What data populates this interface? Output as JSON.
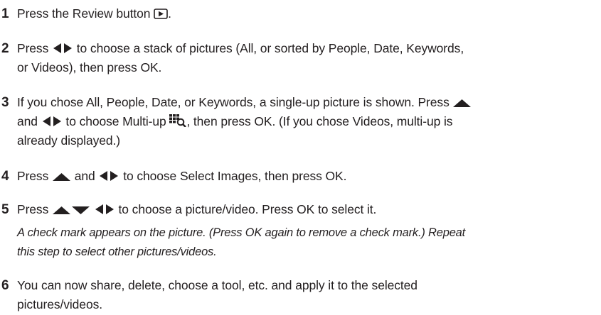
{
  "steps": [
    {
      "num": "1",
      "parts": [
        "Press the Review button ",
        "."
      ]
    },
    {
      "num": "2",
      "parts": [
        "Press ",
        " to choose a stack of pictures (All, or sorted by People, Date, Keywords,",
        "or Videos), then press OK."
      ]
    },
    {
      "num": "3",
      "parts": [
        "If you chose All, People, Date, or Keywords, a single-up picture is shown. Press ",
        "and ",
        " to choose Multi-up ",
        ", then press OK. (If you chose Videos, multi-up is",
        "already displayed.)"
      ]
    },
    {
      "num": "4",
      "parts": [
        "Press ",
        " and ",
        " to choose Select Images, then press OK."
      ]
    },
    {
      "num": "5",
      "parts": [
        "Press ",
        " to choose a picture/video. Press OK to select it."
      ],
      "note": [
        "A check mark appears on the picture. (Press OK again to remove a check mark.) Repeat",
        "this step to select other pictures/videos."
      ]
    },
    {
      "num": "6",
      "parts": [
        "You can now share, delete, choose a tool, etc. and apply it to the selected",
        "pictures/videos."
      ]
    }
  ],
  "icons": {
    "review": "review-button-icon",
    "left_right": "left-right-arrows-icon",
    "up": "up-arrow-icon",
    "down": "down-arrow-icon",
    "multi_up": "multi-up-icon"
  }
}
